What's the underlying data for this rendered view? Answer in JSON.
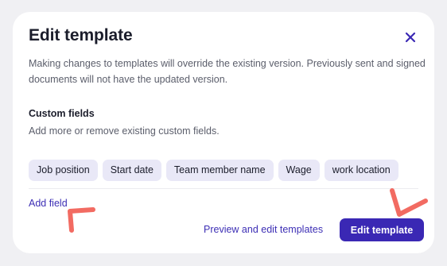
{
  "modal": {
    "title": "Edit template",
    "close_icon": "close-icon",
    "description": "Making changes to templates will override the existing version. Previously sent and signed documents will not have the updated version."
  },
  "custom_fields": {
    "title": "Custom fields",
    "subtitle": "Add more or remove existing custom fields.",
    "chips": [
      "Job position",
      "Start date",
      "Team member name",
      "Wage",
      "work location"
    ],
    "add_field_label": "Add field"
  },
  "footer": {
    "preview_link_label": "Preview and edit templates",
    "primary_button_label": "Edit template"
  },
  "colors": {
    "accent": "#3a28b4",
    "link": "#3d2fb5",
    "chip_bg": "#e9e8f7",
    "annotation": "#f26b62"
  }
}
